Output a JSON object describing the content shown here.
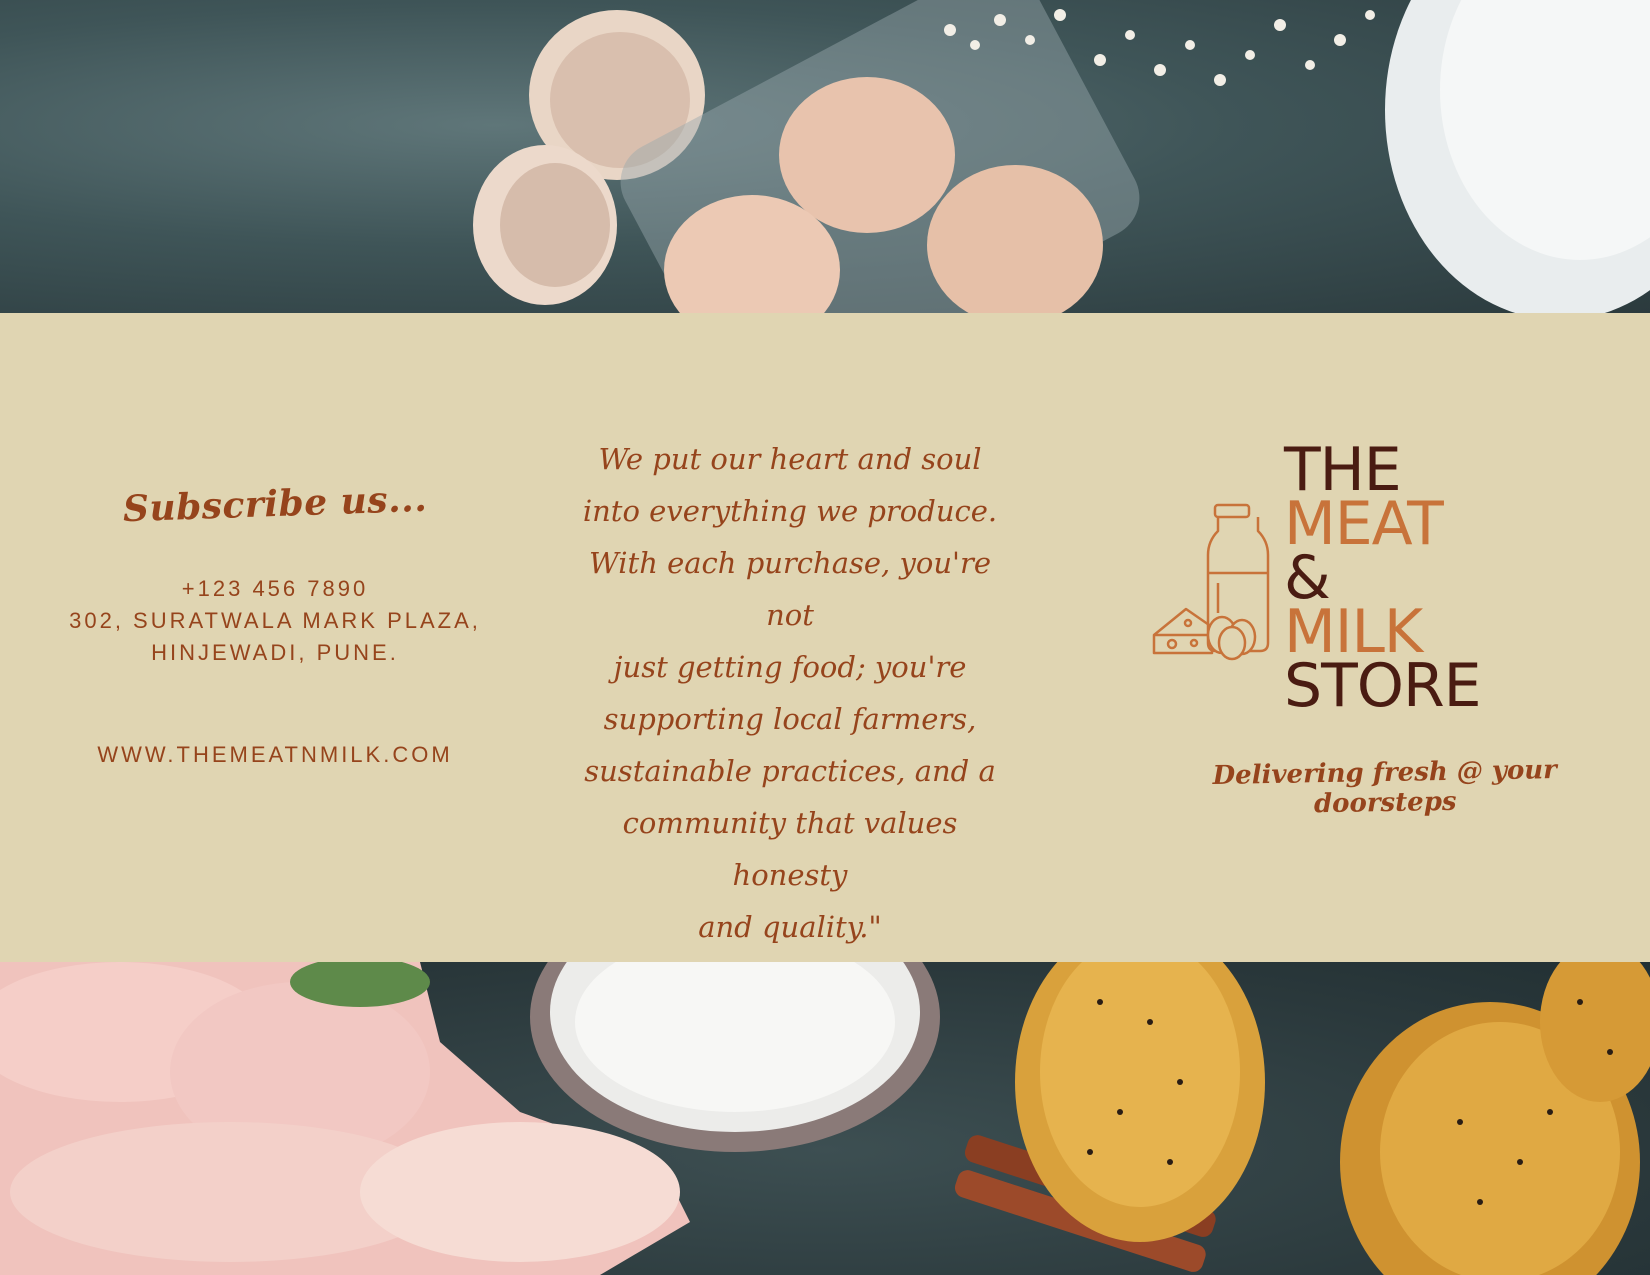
{
  "subscribe": {
    "title": "Subscribe us...",
    "phone": "+123 456 7890",
    "address_line1": "302, SURATWALA MARK PLAZA,",
    "address_line2": "HINJEWADI, PUNE.",
    "website": "WWW.THEMEATNMILK.COM"
  },
  "quote": {
    "lines": [
      "We put our heart and soul",
      "into everything we produce.",
      "With each purchase, you're not",
      "just getting food; you're",
      "supporting local farmers,",
      "sustainable practices, and a",
      "community that values honesty",
      "and quality.\""
    ]
  },
  "logo": {
    "line1": "THE",
    "line2": "MEAT",
    "line3": "&",
    "line4": "MILK",
    "line5": "STORE",
    "tagline": "Delivering fresh @ your doorsteps",
    "icon": "milk-bottle-cheese-eggs-icon"
  },
  "colors": {
    "panel": "#e0d5b2",
    "accent_brown": "#96441c",
    "dark_brown": "#4a1c12",
    "orange": "#c8733a"
  }
}
